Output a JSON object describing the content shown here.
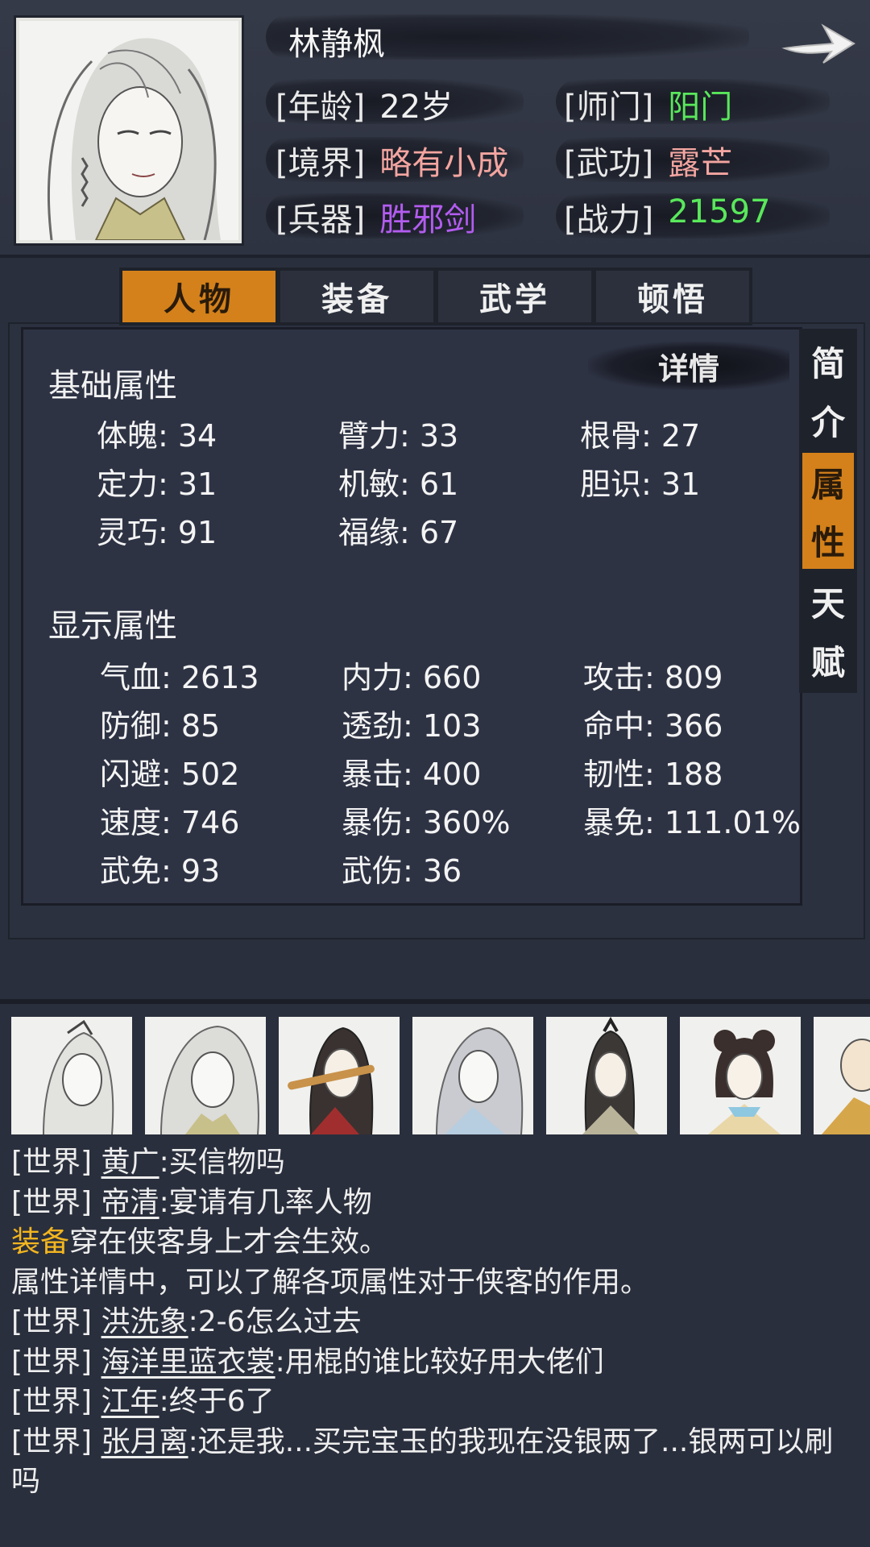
{
  "character": {
    "name": "林静枫",
    "age_label": "[年龄]",
    "age": "22岁",
    "sect_label": "[师门]",
    "sect": "阳门",
    "realm_label": "[境界]",
    "realm": "略有小成",
    "skill_label": "[武功]",
    "skill": "露芒",
    "weapon_label": "[兵器]",
    "weapon": "胜邪剑",
    "power_label": "[战力]",
    "power": "21597"
  },
  "colors": {
    "green": "#59e85b",
    "pink": "#f3a5a0",
    "purple": "#b35cf0",
    "orange": "#d4811b",
    "yellow": "#f2b51f"
  },
  "tabs": [
    "人物",
    "装备",
    "武学",
    "顿悟"
  ],
  "side_tabs": [
    {
      "chars": [
        "简",
        "介"
      ]
    },
    {
      "chars": [
        "属",
        "性"
      ]
    },
    {
      "chars": [
        "天",
        "赋"
      ]
    }
  ],
  "detail_button": "详情",
  "basic": {
    "title": "基础属性",
    "stats": [
      "体魄: 34",
      "臂力: 33",
      "根骨: 27",
      "定力: 31",
      "机敏: 61",
      "胆识: 31",
      "灵巧: 91",
      "福缘: 67"
    ]
  },
  "display": {
    "title": "显示属性",
    "stats": [
      "气血: 2613",
      "内力: 660",
      "攻击: 809",
      "防御: 85",
      "透劲: 103",
      "命中: 366",
      "闪避: 502",
      "暴击: 400",
      "韧性: 188",
      "速度: 746",
      "暴伤: 360%",
      "暴免: 111.01%",
      "武免: 93",
      "武伤: 36"
    ]
  },
  "chat": {
    "lines": [
      {
        "tag": "[世界]",
        "user": "黄广",
        "text": ":买信物吗"
      },
      {
        "tag": "[世界]",
        "user": "帝清",
        "text": ":宴请有几率人物"
      },
      {
        "hl": "装备",
        "text": "穿在侠客身上才会生效。"
      },
      {
        "text": "属性详情中，可以了解各项属性对于侠客的作用。"
      },
      {
        "tag": "[世界]",
        "user": "洪洗象",
        "text": ":2-6怎么过去"
      },
      {
        "tag": "[世界]",
        "user": "海洋里蓝衣裳",
        "text": ":用棍的谁比较好用大佬们"
      },
      {
        "tag": "[世界]",
        "user": "江年",
        "text": ":终于6了"
      },
      {
        "tag": "[世界]",
        "user": "张月离",
        "text": ":还是我...买完宝玉的我现在没银两了...银两可以刷吗"
      }
    ]
  }
}
